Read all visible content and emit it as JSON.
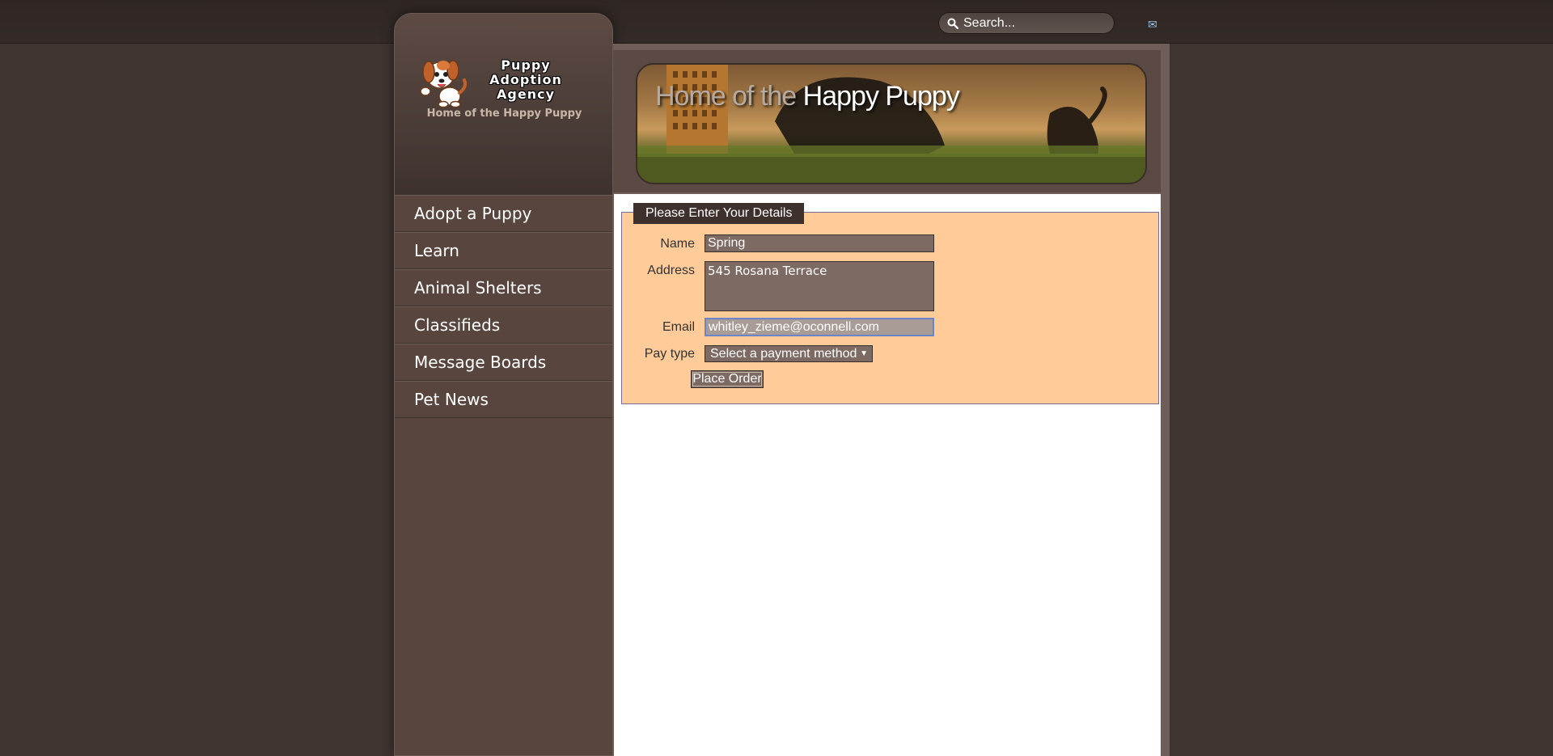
{
  "search": {
    "placeholder": "Search..."
  },
  "brand": {
    "title_line1": "Puppy",
    "title_line2": "Adoption",
    "title_line3": "Agency",
    "tagline": "Home of the Happy Puppy"
  },
  "banner": {
    "text_light": "Home of the ",
    "text_bright": "Happy Puppy"
  },
  "nav": {
    "items": [
      {
        "label": "Adopt a Puppy"
      },
      {
        "label": "Learn"
      },
      {
        "label": "Animal Shelters"
      },
      {
        "label": "Classifieds"
      },
      {
        "label": "Message Boards"
      },
      {
        "label": "Pet News"
      }
    ]
  },
  "form": {
    "legend": "Please Enter Your Details",
    "name_label": "Name",
    "name_value": "Spring",
    "address_label": "Address",
    "address_value": "545 Rosana Terrace",
    "email_label": "Email",
    "email_value": "whitley_zieme@oconnell.com",
    "paytype_label": "Pay type",
    "paytype_selected": "Select a payment method",
    "submit_label": "Place Order"
  },
  "icons": {
    "search": "search-icon",
    "mail": "mail-icon",
    "logo": "puppy-logo-icon",
    "dropdown": "chevron-down-icon"
  }
}
